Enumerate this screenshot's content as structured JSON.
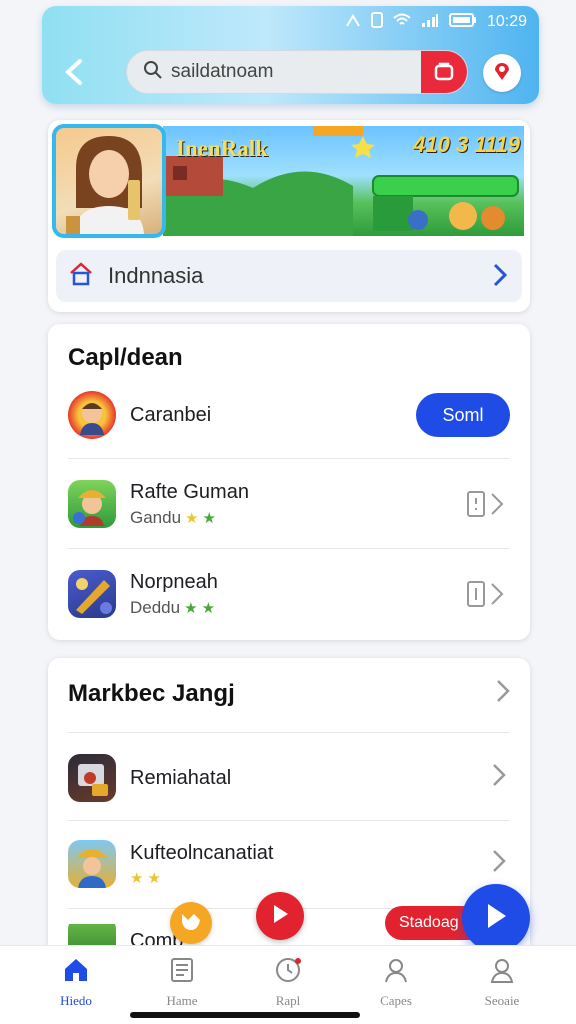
{
  "status_bar": {
    "time": "10:29",
    "icons": [
      "signal-icon",
      "sim-icon",
      "wifi-icon",
      "cell-signal-icon",
      "battery-icon"
    ]
  },
  "header": {
    "search_text": "saildatnoam",
    "back_icon": "back-icon",
    "search_icon": "search-icon"
  },
  "banner": {
    "title": "InenRalk",
    "score": "410 3 1119"
  },
  "region": {
    "label": "Indnnasia"
  },
  "section1": {
    "title": "Capl/dean",
    "featured": {
      "name": "Caranbei",
      "button": "Soml"
    },
    "items": [
      {
        "name": "Rafte Guman",
        "sub": "Gandu"
      },
      {
        "name": "Norpneah",
        "sub": "Deddu"
      }
    ]
  },
  "section2": {
    "title": "Markbec Jangj",
    "items": [
      {
        "name": "Remiahatal",
        "sub": ""
      },
      {
        "name": "Kufteolncanatiat",
        "sub": ""
      },
      {
        "name": "Comb",
        "sub": ""
      }
    ]
  },
  "floating": {
    "pill_label": "Stadoag"
  },
  "tabbar": {
    "tabs": [
      {
        "label": "Hiedo",
        "icon": "home-icon",
        "active": true
      },
      {
        "label": "Hame",
        "icon": "list-icon",
        "active": false
      },
      {
        "label": "Rapl",
        "icon": "clock-icon",
        "active": false
      },
      {
        "label": "Capes",
        "icon": "person-icon",
        "active": false
      },
      {
        "label": "Seoaie",
        "icon": "profile-icon",
        "active": false
      }
    ]
  },
  "colors": {
    "accent": "#1f4be6",
    "red": "#e2232f",
    "header_gradient_start": "#8fe0f2",
    "header_gradient_end": "#4fb4f0"
  }
}
